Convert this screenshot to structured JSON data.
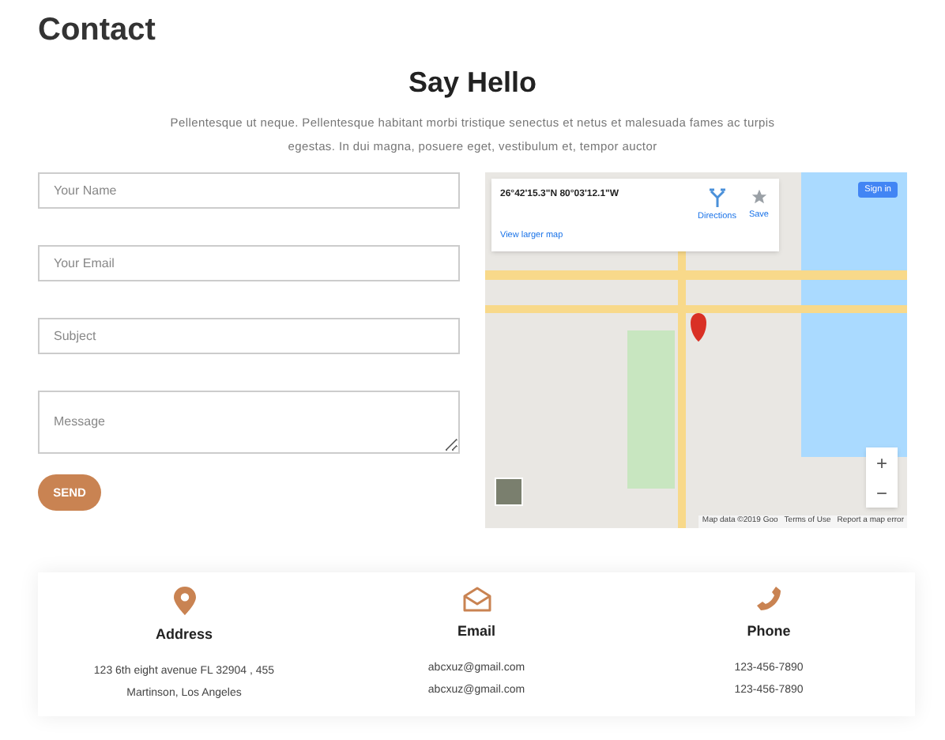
{
  "page_title": "Contact",
  "intro": {
    "heading": "Say Hello",
    "text": "Pellentesque ut neque. Pellentesque habitant morbi tristique senectus et netus et malesuada fames ac turpis egestas. In dui magna, posuere eget, vestibulum et, tempor auctor"
  },
  "form": {
    "fields": [
      {
        "kind": "input",
        "placeholder": "Your Name"
      },
      {
        "kind": "input",
        "placeholder": "Your Email"
      },
      {
        "kind": "input",
        "placeholder": "Subject"
      },
      {
        "kind": "textarea",
        "placeholder": "Message"
      }
    ],
    "submit": "SEND"
  },
  "map": {
    "coordinates": "26°42'15.3\"N 80°03'12.1\"W",
    "actions": [
      "Directions",
      "Save"
    ],
    "larger_map_link": "View larger map",
    "sign_in": "Sign in",
    "zoom_in": "+",
    "zoom_out": "−",
    "footer": [
      "Map data ©2019 Goo",
      "Terms of Use",
      "Report a map error"
    ]
  },
  "info": [
    {
      "kind": "address",
      "title": "Address",
      "lines": [
        "123 6th eight avenue FL 32904 , 455",
        "Martinson, Los Angeles"
      ]
    },
    {
      "kind": "email",
      "title": "Email",
      "lines": [
        "abcxuz@gmail.com",
        "abcxuz@gmail.com"
      ]
    },
    {
      "kind": "phone",
      "title": "Phone",
      "lines": [
        "123-456-7890",
        "123-456-7890"
      ]
    }
  ]
}
